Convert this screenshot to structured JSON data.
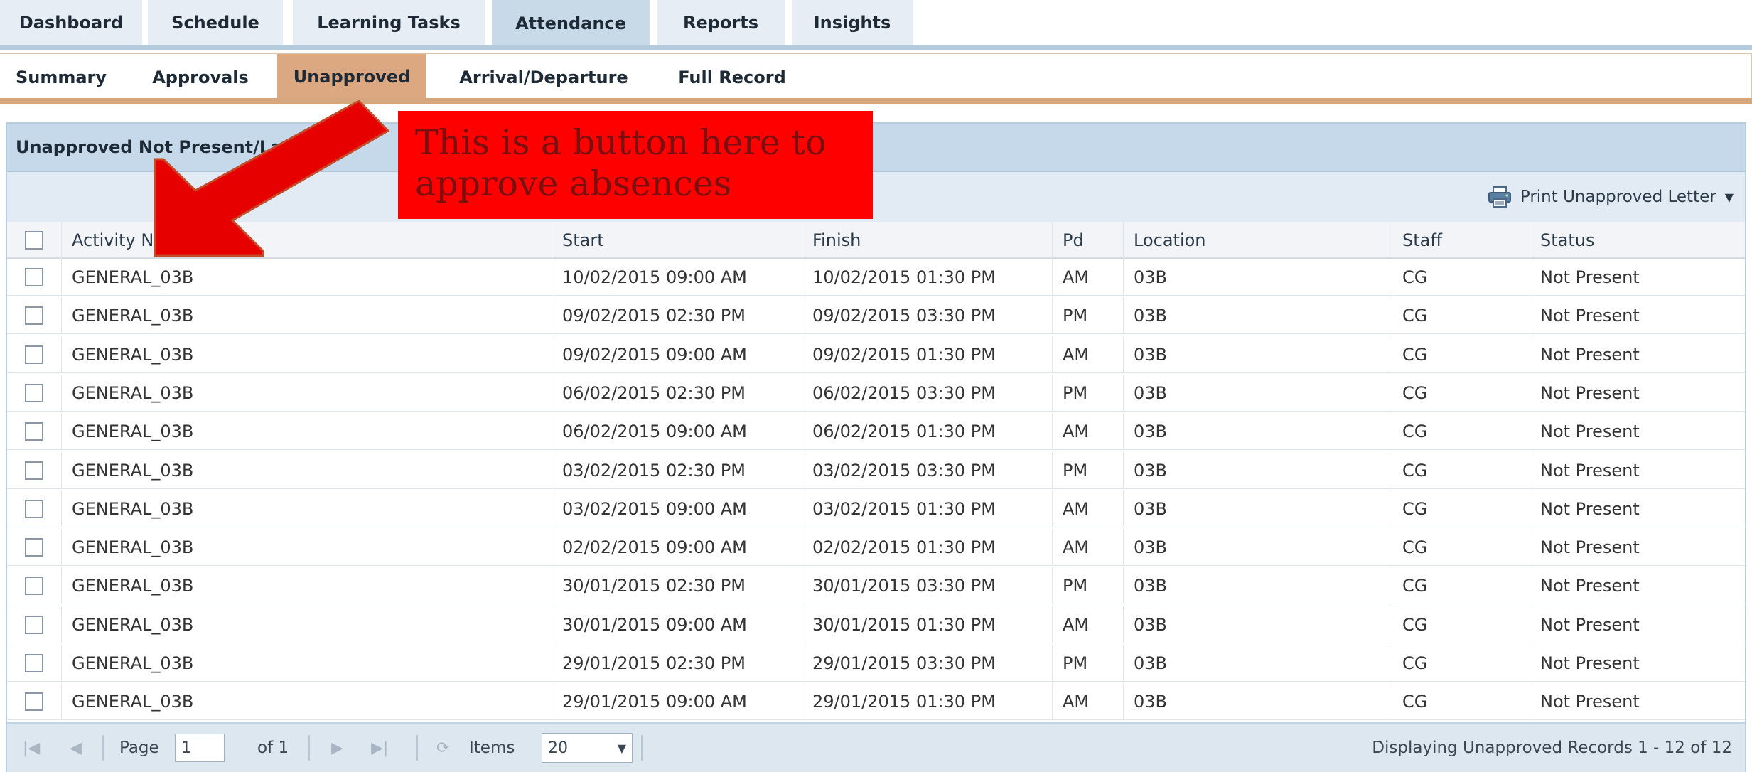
{
  "top_tabs": [
    {
      "label": "Dashboard"
    },
    {
      "label": "Schedule"
    },
    {
      "label": "Learning Tasks"
    },
    {
      "label": "Attendance",
      "active": true
    },
    {
      "label": "Reports"
    },
    {
      "label": "Insights"
    }
  ],
  "sub_tabs": [
    {
      "label": "Summary"
    },
    {
      "label": "Approvals"
    },
    {
      "label": "Unapproved",
      "active": true
    },
    {
      "label": "Arrival/Departure"
    },
    {
      "label": "Full Record"
    }
  ],
  "panel": {
    "title": "Unapproved Not Present/Late",
    "print_label": "Print Unapproved Letter",
    "icon": "printer-icon"
  },
  "table": {
    "columns": [
      "Activity Name",
      "Start",
      "Finish",
      "Pd",
      "Location",
      "Staff",
      "Status"
    ],
    "rows": [
      [
        "GENERAL_03B",
        "10/02/2015 09:00 AM",
        "10/02/2015 01:30 PM",
        "AM",
        "03B",
        "CG",
        "Not Present"
      ],
      [
        "GENERAL_03B",
        "09/02/2015 02:30 PM",
        "09/02/2015 03:30 PM",
        "PM",
        "03B",
        "CG",
        "Not Present"
      ],
      [
        "GENERAL_03B",
        "09/02/2015 09:00 AM",
        "09/02/2015 01:30 PM",
        "AM",
        "03B",
        "CG",
        "Not Present"
      ],
      [
        "GENERAL_03B",
        "06/02/2015 02:30 PM",
        "06/02/2015 03:30 PM",
        "PM",
        "03B",
        "CG",
        "Not Present"
      ],
      [
        "GENERAL_03B",
        "06/02/2015 09:00 AM",
        "06/02/2015 01:30 PM",
        "AM",
        "03B",
        "CG",
        "Not Present"
      ],
      [
        "GENERAL_03B",
        "03/02/2015 02:30 PM",
        "03/02/2015 03:30 PM",
        "PM",
        "03B",
        "CG",
        "Not Present"
      ],
      [
        "GENERAL_03B",
        "03/02/2015 09:00 AM",
        "03/02/2015 01:30 PM",
        "AM",
        "03B",
        "CG",
        "Not Present"
      ],
      [
        "GENERAL_03B",
        "02/02/2015 09:00 AM",
        "02/02/2015 01:30 PM",
        "AM",
        "03B",
        "CG",
        "Not Present"
      ],
      [
        "GENERAL_03B",
        "30/01/2015 02:30 PM",
        "30/01/2015 03:30 PM",
        "PM",
        "03B",
        "CG",
        "Not Present"
      ],
      [
        "GENERAL_03B",
        "30/01/2015 09:00 AM",
        "30/01/2015 01:30 PM",
        "AM",
        "03B",
        "CG",
        "Not Present"
      ],
      [
        "GENERAL_03B",
        "29/01/2015 02:30 PM",
        "29/01/2015 03:30 PM",
        "PM",
        "03B",
        "CG",
        "Not Present"
      ],
      [
        "GENERAL_03B",
        "29/01/2015 09:00 AM",
        "29/01/2015 01:30 PM",
        "AM",
        "03B",
        "CG",
        "Not Present"
      ]
    ]
  },
  "pager": {
    "page_label": "Page",
    "page_value": "1",
    "of_label": "of 1",
    "items_label": "Items",
    "items_value": "20",
    "status": "Displaying Unapproved Records 1 - 12 of 12"
  },
  "annotation": {
    "text": "This is a button here to approve absences",
    "color": "#ff0000"
  },
  "colors": {
    "active_top_tab": "#c8d9e8",
    "active_sub_tab": "#dba882",
    "panel_header": "#c5d9ea"
  }
}
